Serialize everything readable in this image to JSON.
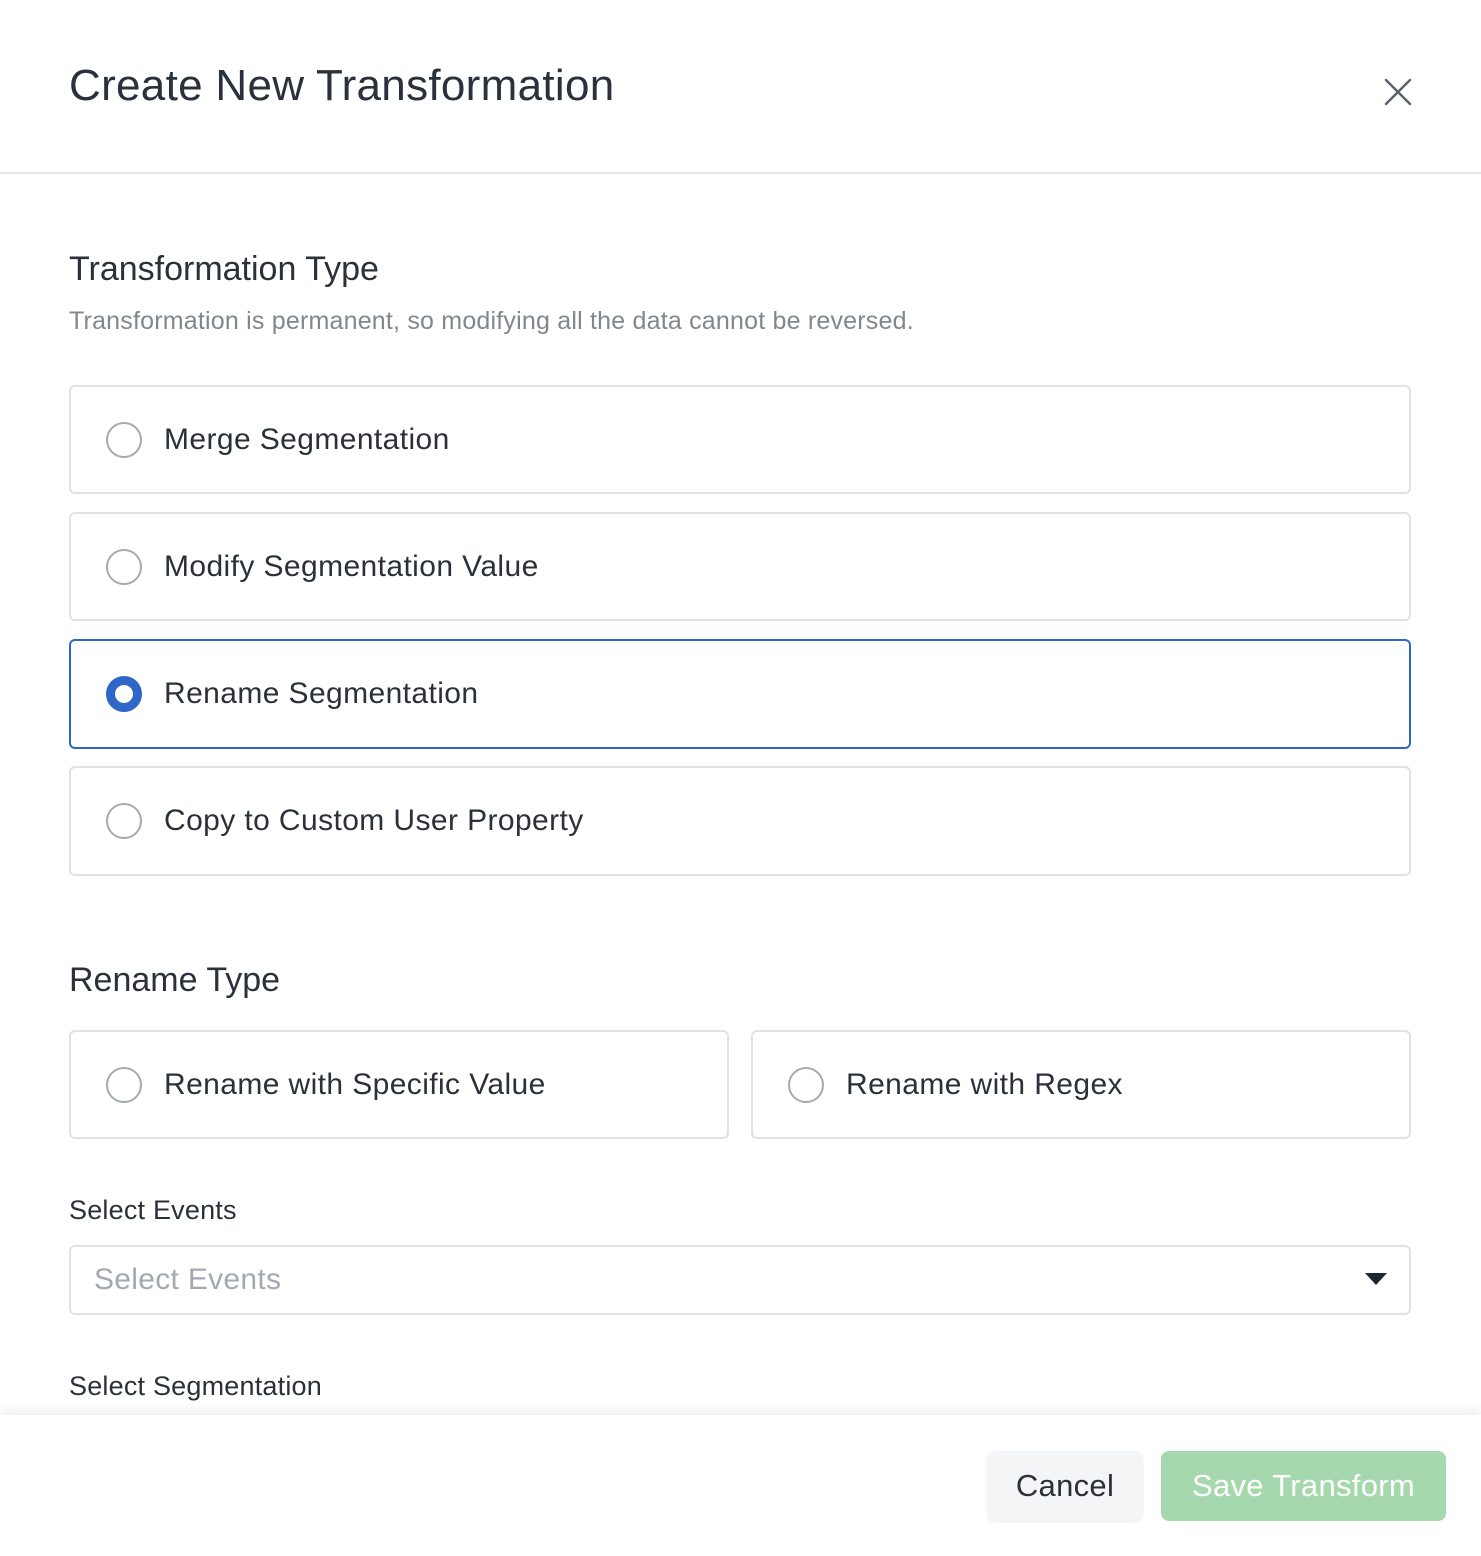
{
  "dialog": {
    "title": "Create New Transformation"
  },
  "transformation_type": {
    "title": "Transformation Type",
    "subtitle": "Transformation is permanent, so modifying all the data cannot be reversed.",
    "options": [
      {
        "label": "Merge Segmentation",
        "selected": false
      },
      {
        "label": "Modify Segmentation Value",
        "selected": false
      },
      {
        "label": "Rename Segmentation",
        "selected": true
      },
      {
        "label": "Copy to Custom User Property",
        "selected": false
      }
    ]
  },
  "rename_type": {
    "title": "Rename Type",
    "options": [
      {
        "label": "Rename with Specific Value",
        "selected": false
      },
      {
        "label": "Rename with Regex",
        "selected": false
      }
    ]
  },
  "select_events": {
    "label": "Select Events",
    "placeholder": "Select Events"
  },
  "select_segmentation": {
    "label": "Select Segmentation"
  },
  "footer": {
    "cancel_label": "Cancel",
    "save_label": "Save Transform"
  },
  "colors": {
    "accent": "#2f67c9",
    "save_disabled": "#a6d8ad"
  }
}
